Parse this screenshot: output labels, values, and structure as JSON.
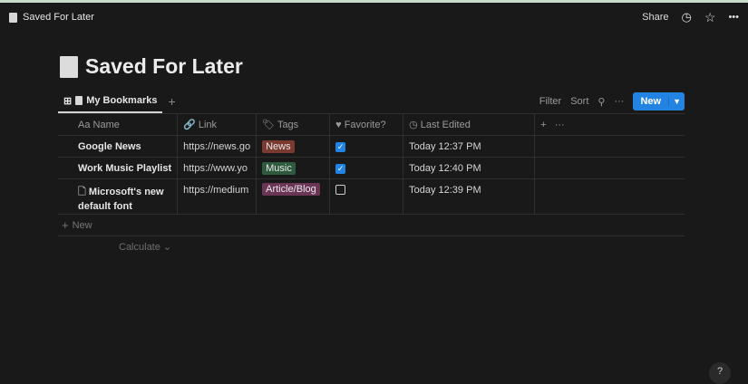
{
  "topbar": {
    "title": "Saved For Later",
    "share": "Share",
    "history_icon": "clock-icon",
    "favorite_icon": "star-icon",
    "more": "•••"
  },
  "page": {
    "title": "Saved For Later"
  },
  "view": {
    "tab": "My Bookmarks",
    "add": "+",
    "filter": "Filter",
    "sort": "Sort",
    "more": "···",
    "new": "New"
  },
  "columns": {
    "name": "Aa Name",
    "link": "Link",
    "tags": "Tags",
    "favorite": "Favorite?",
    "edited": "Last Edited",
    "add": "+",
    "more": "···"
  },
  "rows": [
    {
      "name": "Google News",
      "link": "https://news.go",
      "tag": "News",
      "tag_color": "#7a3a30",
      "favorite": true,
      "edited": "Today 12:37 PM"
    },
    {
      "name": "Work Music Playlist",
      "link": "https://www.yo",
      "tag": "Music",
      "tag_color": "#2f5a3e",
      "favorite": true,
      "edited": "Today 12:40 PM"
    },
    {
      "name": "Microsoft's new default font",
      "link": "https://medium",
      "tag": "Article/Blog",
      "tag_color": "#6b3556",
      "favorite": false,
      "edited": "Today 12:39 PM"
    }
  ],
  "new_row": "New",
  "calculate": "Calculate ⌄",
  "help": "?"
}
